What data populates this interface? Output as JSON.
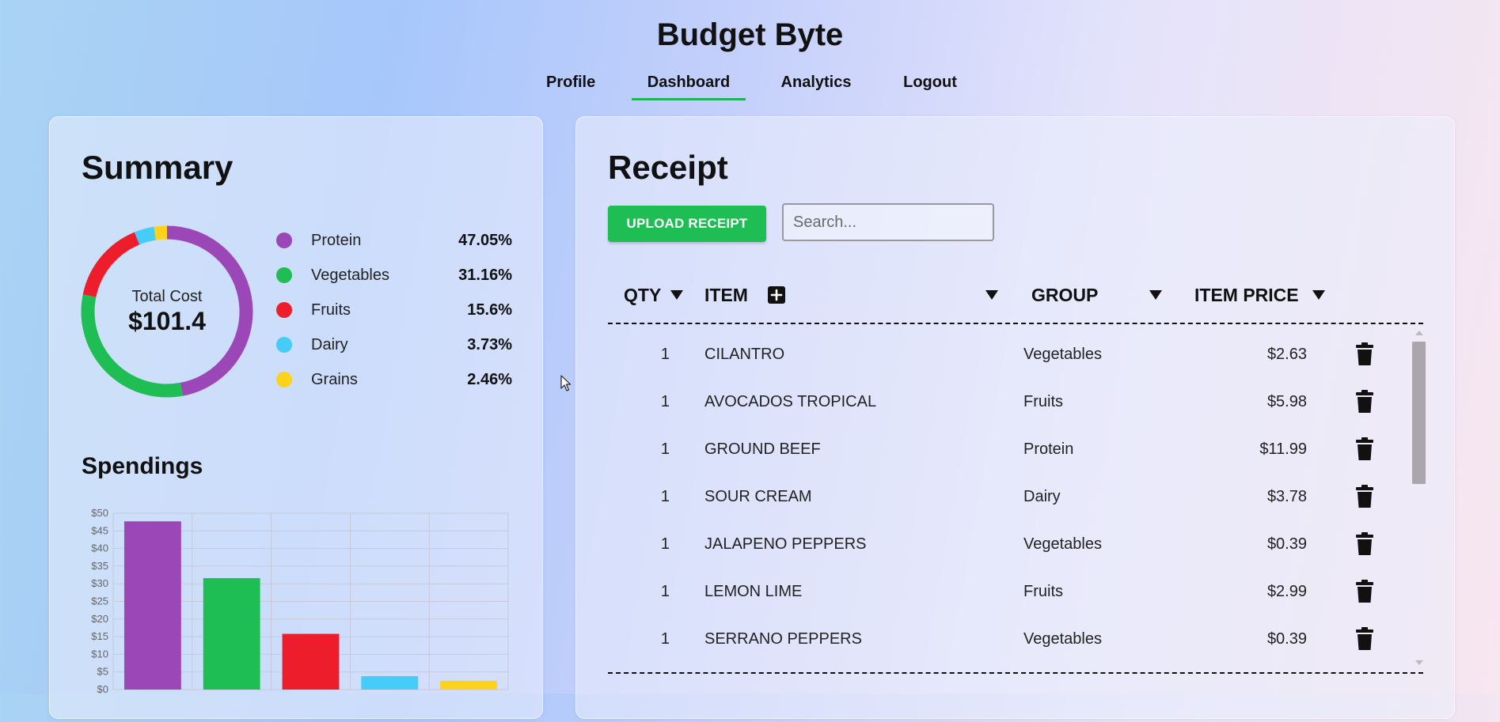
{
  "app": {
    "title": "Budget Byte"
  },
  "nav": {
    "items": [
      {
        "label": "Profile",
        "active": false
      },
      {
        "label": "Dashboard",
        "active": true
      },
      {
        "label": "Analytics",
        "active": false
      },
      {
        "label": "Logout",
        "active": false
      }
    ]
  },
  "summary": {
    "title": "Summary",
    "total_label": "Total Cost",
    "total_value": "$101.4",
    "categories": [
      {
        "name": "Protein",
        "percent": "47.05%",
        "value": 47.05,
        "color": "#9b47b8"
      },
      {
        "name": "Vegetables",
        "percent": "31.16%",
        "value": 31.16,
        "color": "#1fbe54"
      },
      {
        "name": "Fruits",
        "percent": "15.6%",
        "value": 15.6,
        "color": "#ee1d2c"
      },
      {
        "name": "Dairy",
        "percent": "3.73%",
        "value": 3.73,
        "color": "#45ccf9"
      },
      {
        "name": "Grains",
        "percent": "2.46%",
        "value": 2.46,
        "color": "#fbd31c"
      }
    ]
  },
  "spendings": {
    "title": "Spendings"
  },
  "chart_data": {
    "type": "bar",
    "categories": [
      "Protein",
      "Vegetables",
      "Fruits",
      "Dairy",
      "Grains"
    ],
    "values": [
      47.7,
      31.6,
      15.8,
      3.8,
      2.5
    ],
    "colors": [
      "#9b47b8",
      "#1fbe54",
      "#ee1d2c",
      "#45ccf9",
      "#fbd31c"
    ],
    "y_ticks": [
      "$0",
      "$5",
      "$10",
      "$15",
      "$20",
      "$25",
      "$30",
      "$35",
      "$40",
      "$45",
      "$50"
    ],
    "ylim": [
      0,
      50
    ],
    "grid": true,
    "title": "",
    "xlabel": "",
    "ylabel": ""
  },
  "receipt": {
    "title": "Receipt",
    "upload_label": "UPLOAD RECEIPT",
    "search_placeholder": "Search...",
    "search_value": "",
    "columns": {
      "qty": "QTY",
      "item": "ITEM",
      "group": "GROUP",
      "price": "ITEM PRICE"
    },
    "rows": [
      {
        "qty": "1",
        "item": "CILANTRO",
        "group": "Vegetables",
        "price": "$2.63"
      },
      {
        "qty": "1",
        "item": "AVOCADOS TROPICAL",
        "group": "Fruits",
        "price": "$5.98"
      },
      {
        "qty": "1",
        "item": "GROUND BEEF",
        "group": "Protein",
        "price": "$11.99"
      },
      {
        "qty": "1",
        "item": "SOUR CREAM",
        "group": "Dairy",
        "price": "$3.78"
      },
      {
        "qty": "1",
        "item": "JALAPENO PEPPERS",
        "group": "Vegetables",
        "price": "$0.39"
      },
      {
        "qty": "1",
        "item": "LEMON LIME",
        "group": "Fruits",
        "price": "$2.99"
      },
      {
        "qty": "1",
        "item": "SERRANO PEPPERS",
        "group": "Vegetables",
        "price": "$0.39"
      }
    ]
  }
}
